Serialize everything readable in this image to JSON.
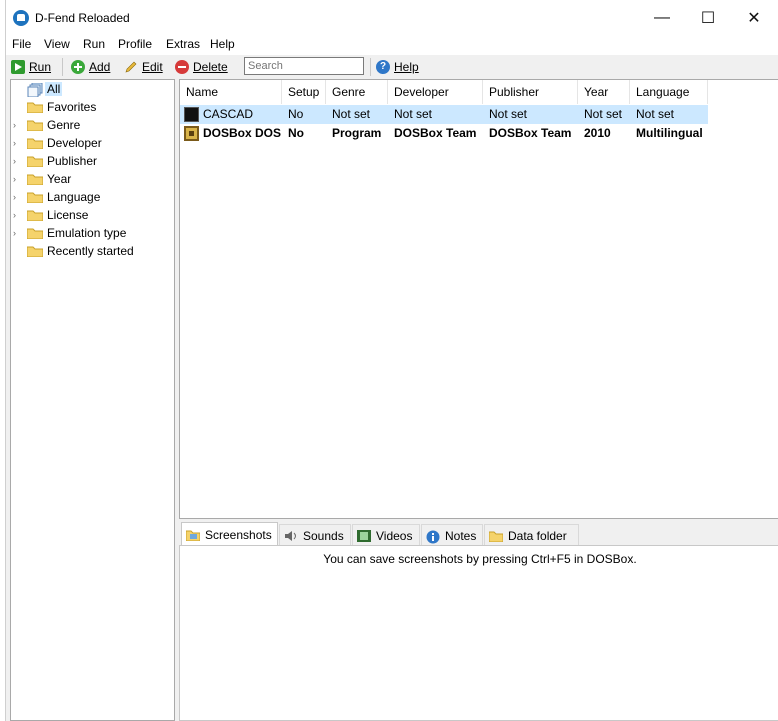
{
  "window": {
    "title": "D-Fend Reloaded",
    "minimize": "—",
    "maximize": "☐",
    "close": "✕"
  },
  "menu": [
    "File",
    "View",
    "Run",
    "Profile",
    "Extras",
    "Help"
  ],
  "toolbar": {
    "run": "Run",
    "add": "Add",
    "edit": "Edit",
    "delete": "Delete",
    "search_placeholder": "Search",
    "help": "Help"
  },
  "tree": [
    {
      "label": "All",
      "expandable": false,
      "selected": true
    },
    {
      "label": "Favorites",
      "expandable": false
    },
    {
      "label": "Genre",
      "expandable": true
    },
    {
      "label": "Developer",
      "expandable": true
    },
    {
      "label": "Publisher",
      "expandable": true
    },
    {
      "label": "Year",
      "expandable": true
    },
    {
      "label": "Language",
      "expandable": true
    },
    {
      "label": "License",
      "expandable": true
    },
    {
      "label": "Emulation type",
      "expandable": true
    },
    {
      "label": "Recently started",
      "expandable": false
    }
  ],
  "columns": [
    "Name",
    "Setup",
    "Genre",
    "Developer",
    "Publisher",
    "Year",
    "Language"
  ],
  "rows": [
    {
      "name": "CASCAD",
      "setup": "No",
      "genre": "Not set",
      "developer": "Not set",
      "publisher": "Not set",
      "year": "Not set",
      "language": "Not set",
      "selected": true,
      "bold": false
    },
    {
      "name": "DOSBox DOS",
      "setup": "No",
      "genre": "Program",
      "developer": "DOSBox Team",
      "publisher": "DOSBox Team",
      "year": "2010",
      "language": "Multilingual",
      "selected": false,
      "bold": true
    }
  ],
  "tabs": [
    "Screenshots",
    "Sounds",
    "Videos",
    "Notes",
    "Data folder"
  ],
  "panel_hint": "You can save screenshots by pressing Ctrl+F5 in DOSBox.",
  "colors": {
    "selection": "#cce8ff",
    "app_icon": "#1e73be"
  }
}
